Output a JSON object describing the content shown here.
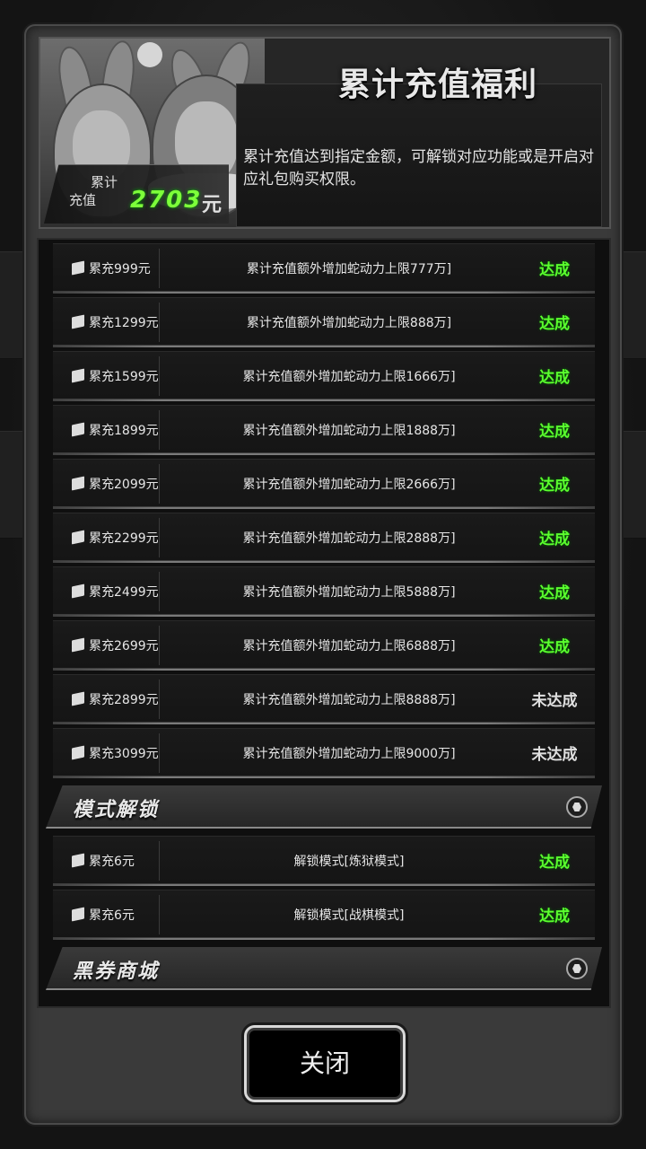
{
  "header": {
    "title": "累计充值福利",
    "description": "累计充值达到指定金额，可解锁对应功能或是开启对应礼包购买权限。",
    "total_label_line1": "累计",
    "total_label_line2": "充值",
    "total_amount": "2703",
    "total_unit": "元"
  },
  "rows": [
    {
      "cond": "累充999元",
      "reward": "累计充值额外增加蛇动力上限777万]",
      "status": "达成",
      "done": true
    },
    {
      "cond": "累充1299元",
      "reward": "累计充值额外增加蛇动力上限888万]",
      "status": "达成",
      "done": true
    },
    {
      "cond": "累充1599元",
      "reward": "累计充值额外增加蛇动力上限1666万]",
      "status": "达成",
      "done": true
    },
    {
      "cond": "累充1899元",
      "reward": "累计充值额外增加蛇动力上限1888万]",
      "status": "达成",
      "done": true
    },
    {
      "cond": "累充2099元",
      "reward": "累计充值额外增加蛇动力上限2666万]",
      "status": "达成",
      "done": true
    },
    {
      "cond": "累充2299元",
      "reward": "累计充值额外增加蛇动力上限2888万]",
      "status": "达成",
      "done": true
    },
    {
      "cond": "累充2499元",
      "reward": "累计充值额外增加蛇动力上限5888万]",
      "status": "达成",
      "done": true
    },
    {
      "cond": "累充2699元",
      "reward": "累计充值额外增加蛇动力上限6888万]",
      "status": "达成",
      "done": true
    },
    {
      "cond": "累充2899元",
      "reward": "累计充值额外增加蛇动力上限8888万]",
      "status": "未达成",
      "done": false
    },
    {
      "cond": "累充3099元",
      "reward": "累计充值额外增加蛇动力上限9000万]",
      "status": "未达成",
      "done": false
    }
  ],
  "section_mode": {
    "title": "模式解锁",
    "rows": [
      {
        "cond": "累充6元",
        "reward": "解锁模式[炼狱模式]",
        "status": "达成",
        "done": true
      },
      {
        "cond": "累充6元",
        "reward": "解锁模式[战棋模式]",
        "status": "达成",
        "done": true
      }
    ]
  },
  "section_shop": {
    "title": "黑券商城"
  },
  "close_label": "关闭",
  "colors": {
    "done": "#5bff2e",
    "todo": "#e0e0e0",
    "amount": "#7dff3a"
  }
}
